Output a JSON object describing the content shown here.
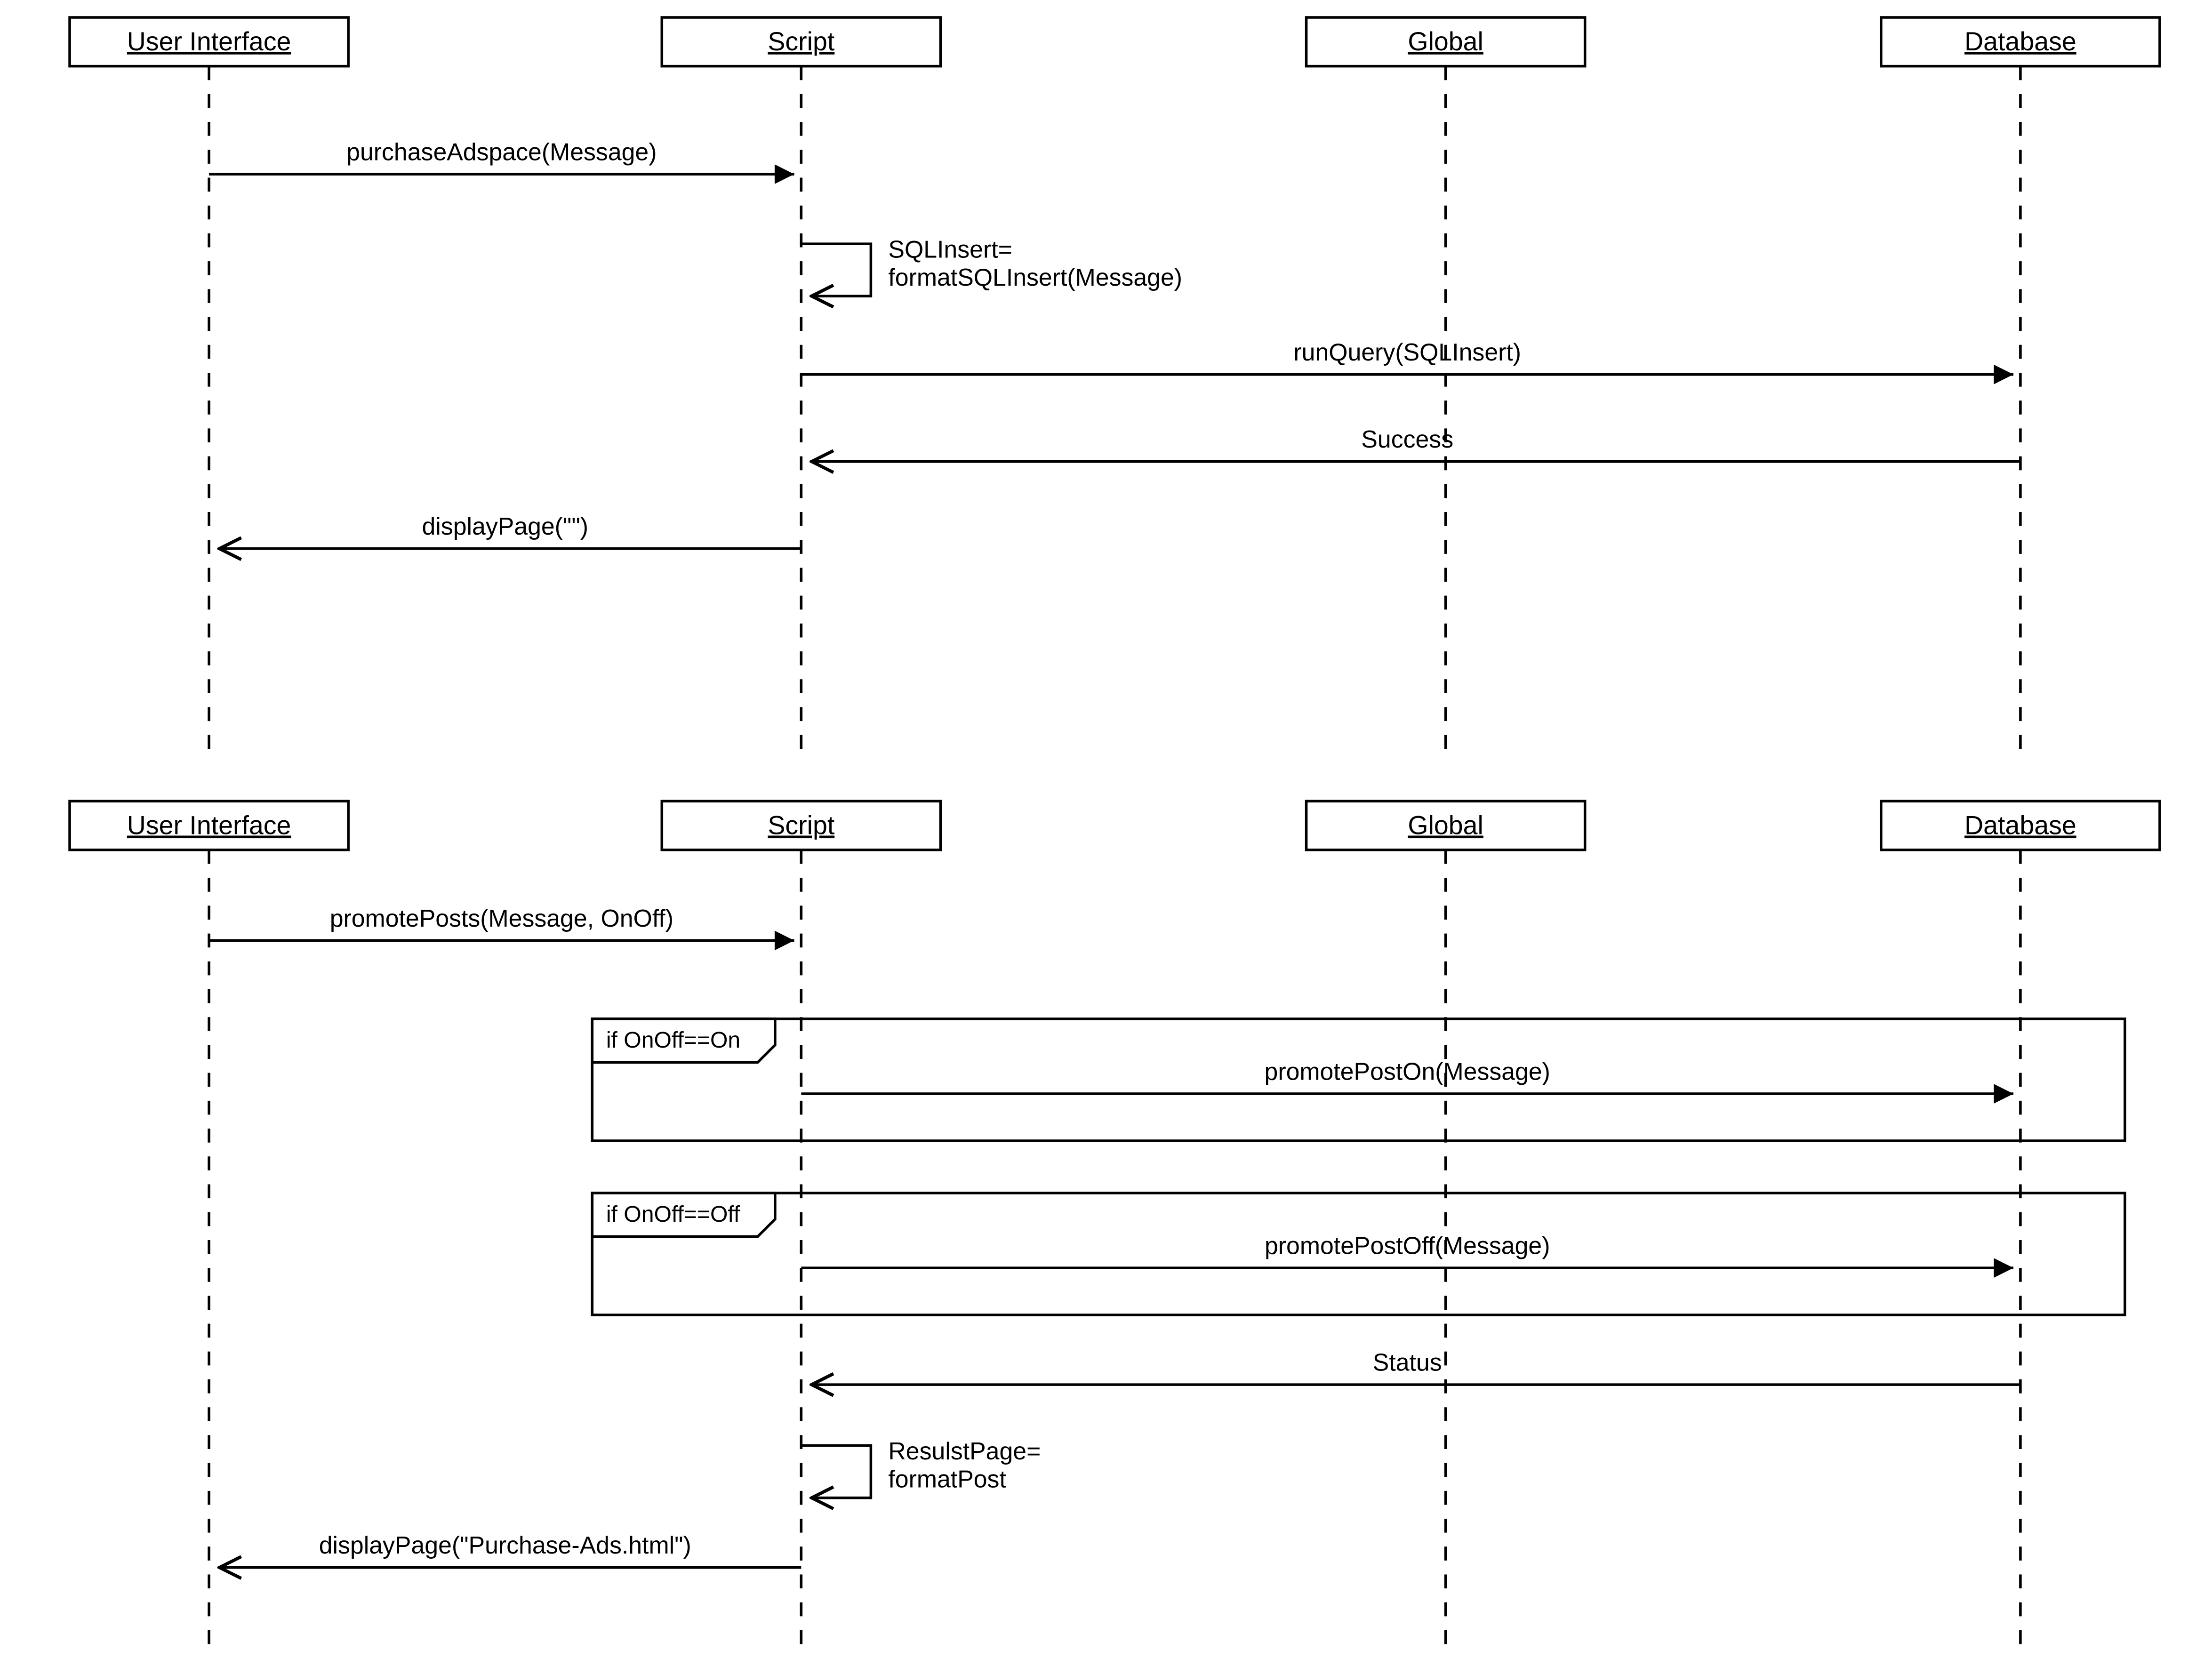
{
  "diagrams": [
    {
      "lifelines": [
        {
          "id": "ui",
          "label": "User Interface"
        },
        {
          "id": "script",
          "label": "Script"
        },
        {
          "id": "global",
          "label": "Global"
        },
        {
          "id": "db",
          "label": "Database"
        }
      ],
      "messages": [
        {
          "kind": "call",
          "label": "purchaseAdspace(Message)"
        },
        {
          "kind": "self",
          "label_lines": [
            "SQLInsert=",
            "formatSQLInsert(Message)"
          ]
        },
        {
          "kind": "call",
          "label": "runQuery(SQLInsert)"
        },
        {
          "kind": "return",
          "label": "Success"
        },
        {
          "kind": "return",
          "label": "displayPage(\"\")"
        }
      ]
    },
    {
      "lifelines": [
        {
          "id": "ui",
          "label": "User Interface"
        },
        {
          "id": "script",
          "label": "Script"
        },
        {
          "id": "global",
          "label": "Global"
        },
        {
          "id": "db",
          "label": "Database"
        }
      ],
      "messages": [
        {
          "kind": "call",
          "label": "promotePosts(Message, OnOff)"
        },
        {
          "kind": "fragment",
          "guard": "if OnOff==On",
          "inner": {
            "kind": "call",
            "label": "promotePostOn(Message)"
          }
        },
        {
          "kind": "fragment",
          "guard": "if OnOff==Off",
          "inner": {
            "kind": "call",
            "label": "promotePostOff(Message)"
          }
        },
        {
          "kind": "return",
          "label": "Status"
        },
        {
          "kind": "self",
          "label_lines": [
            "ResulstPage=",
            "formatPost"
          ]
        },
        {
          "kind": "return",
          "label": "displayPage(\"Purchase-Ads.html\")"
        }
      ]
    }
  ]
}
